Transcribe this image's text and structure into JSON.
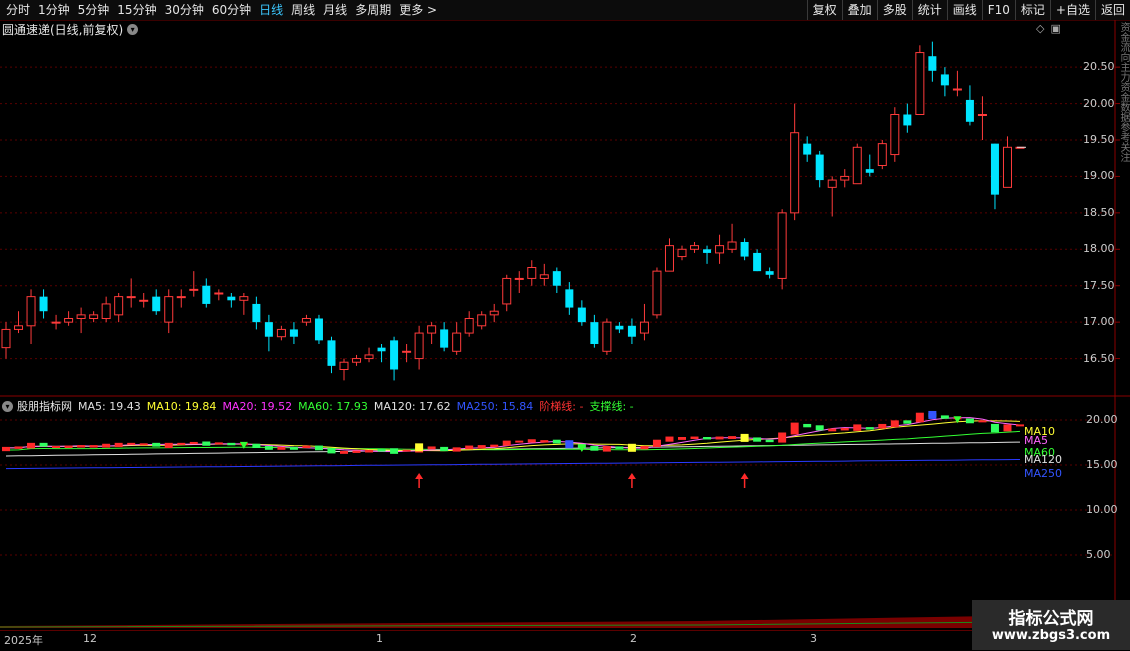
{
  "toolbar": {
    "periods": [
      "分时",
      "1分钟",
      "5分钟",
      "15分钟",
      "30分钟",
      "60分钟",
      "日线",
      "周线",
      "月线",
      "多周期",
      "更多 >"
    ],
    "active_period": "日线",
    "buttons": [
      "复权",
      "叠加",
      "多股",
      "统计",
      "画线",
      "F10",
      "标记",
      "+自选",
      "返回"
    ]
  },
  "stock_title": "圆通速递(日线,前复权)",
  "price_axis": [
    "20.50",
    "20.00",
    "19.50",
    "19.00",
    "18.50",
    "18.00",
    "17.50",
    "17.00",
    "16.50"
  ],
  "indicator": {
    "name": "股朋指标网",
    "ma": [
      {
        "label": "MA5: 19.43",
        "color": "#e0e0e0"
      },
      {
        "label": "MA10: 19.84",
        "color": "#ffff33"
      },
      {
        "label": "MA20: 19.52",
        "color": "#ff33ff"
      },
      {
        "label": "MA60: 17.93",
        "color": "#33ff33"
      },
      {
        "label": "MA120: 17.62",
        "color": "#e0e0e0"
      },
      {
        "label": "MA250: 15.84",
        "color": "#3355ff"
      }
    ],
    "step_line": "阶梯线: -",
    "support_line": "支撑线: -",
    "axis": [
      "20.00",
      "15.00",
      "10.00",
      "5.00"
    ],
    "line_labels": [
      {
        "label": "MA10",
        "color": "#ffff33"
      },
      {
        "label": "MA5",
        "color": "#ff66ff"
      },
      {
        "label": "MA60",
        "color": "#33ff33"
      },
      {
        "label": "MA120",
        "color": "#e0e0e0"
      },
      {
        "label": "MA250",
        "color": "#3355ff"
      }
    ]
  },
  "dates": [
    "2025年",
    "12",
    "1",
    "2",
    "3"
  ],
  "side_text": "资金流向主力资金数据参考关注",
  "watermark": {
    "line1": "指标公式网",
    "line2": "www.zbgs3.com"
  },
  "chart_data": {
    "type": "candlestick",
    "ylim": [
      16.0,
      20.9
    ],
    "candles": [
      [
        16.65,
        16.9,
        16.5,
        17.0
      ],
      [
        16.9,
        16.95,
        16.85,
        17.15
      ],
      [
        16.95,
        17.35,
        16.7,
        17.45
      ],
      [
        17.35,
        17.15,
        17.05,
        17.45
      ],
      [
        17.0,
        17.0,
        16.9,
        17.1
      ],
      [
        17.0,
        17.05,
        16.95,
        17.15
      ],
      [
        17.05,
        17.1,
        16.85,
        17.2
      ],
      [
        17.05,
        17.1,
        17.0,
        17.15
      ],
      [
        17.05,
        17.25,
        17.0,
        17.35
      ],
      [
        17.1,
        17.35,
        17.0,
        17.4
      ],
      [
        17.35,
        17.35,
        17.2,
        17.6
      ],
      [
        17.3,
        17.3,
        17.2,
        17.4
      ],
      [
        17.35,
        17.15,
        17.1,
        17.45
      ],
      [
        17.0,
        17.35,
        16.85,
        17.45
      ],
      [
        17.35,
        17.35,
        17.2,
        17.45
      ],
      [
        17.45,
        17.45,
        17.35,
        17.7
      ],
      [
        17.5,
        17.25,
        17.2,
        17.6
      ],
      [
        17.4,
        17.4,
        17.3,
        17.45
      ],
      [
        17.35,
        17.3,
        17.2,
        17.4
      ],
      [
        17.3,
        17.35,
        17.1,
        17.4
      ],
      [
        17.25,
        17.0,
        16.9,
        17.35
      ],
      [
        17.0,
        16.8,
        16.6,
        17.1
      ],
      [
        16.8,
        16.9,
        16.75,
        16.95
      ],
      [
        16.9,
        16.8,
        16.7,
        17.0
      ],
      [
        17.0,
        17.05,
        16.95,
        17.1
      ],
      [
        17.05,
        16.75,
        16.7,
        17.1
      ],
      [
        16.75,
        16.4,
        16.3,
        16.8
      ],
      [
        16.35,
        16.45,
        16.2,
        16.5
      ],
      [
        16.45,
        16.5,
        16.4,
        16.55
      ],
      [
        16.5,
        16.55,
        16.45,
        16.65
      ],
      [
        16.65,
        16.6,
        16.45,
        16.7
      ],
      [
        16.75,
        16.35,
        16.2,
        16.8
      ],
      [
        16.6,
        16.6,
        16.45,
        16.7
      ],
      [
        16.5,
        16.85,
        16.35,
        16.95
      ],
      [
        16.85,
        16.95,
        16.7,
        17.0
      ],
      [
        16.9,
        16.65,
        16.6,
        17.0
      ],
      [
        16.6,
        16.85,
        16.55,
        17.0
      ],
      [
        16.85,
        17.05,
        16.8,
        17.15
      ],
      [
        16.95,
        17.1,
        16.9,
        17.15
      ],
      [
        17.1,
        17.15,
        17.0,
        17.25
      ],
      [
        17.25,
        17.6,
        17.15,
        17.65
      ],
      [
        17.6,
        17.6,
        17.4,
        17.7
      ],
      [
        17.6,
        17.75,
        17.5,
        17.85
      ],
      [
        17.6,
        17.65,
        17.5,
        17.8
      ],
      [
        17.7,
        17.5,
        17.4,
        17.75
      ],
      [
        17.45,
        17.2,
        17.1,
        17.55
      ],
      [
        17.2,
        17.0,
        16.95,
        17.3
      ],
      [
        17.0,
        16.7,
        16.65,
        17.1
      ],
      [
        16.6,
        17.0,
        16.55,
        17.05
      ],
      [
        16.95,
        16.9,
        16.85,
        17.0
      ],
      [
        16.95,
        16.8,
        16.7,
        17.05
      ],
      [
        16.85,
        17.0,
        16.75,
        17.25
      ],
      [
        17.1,
        17.7,
        17.05,
        17.75
      ],
      [
        17.7,
        18.05,
        17.7,
        18.15
      ],
      [
        17.9,
        18.0,
        17.85,
        18.05
      ],
      [
        18.0,
        18.05,
        17.95,
        18.1
      ],
      [
        18.0,
        17.95,
        17.8,
        18.05
      ],
      [
        17.95,
        18.05,
        17.8,
        18.2
      ],
      [
        18.0,
        18.1,
        17.95,
        18.35
      ],
      [
        18.1,
        17.9,
        17.85,
        18.15
      ],
      [
        17.95,
        17.7,
        17.7,
        18.0
      ],
      [
        17.7,
        17.65,
        17.6,
        17.75
      ],
      [
        17.6,
        18.5,
        17.45,
        18.55
      ],
      [
        18.5,
        19.6,
        18.4,
        20.0
      ],
      [
        19.45,
        19.3,
        19.2,
        19.55
      ],
      [
        19.3,
        18.95,
        18.85,
        19.35
      ],
      [
        18.85,
        18.95,
        18.45,
        19.0
      ],
      [
        18.95,
        19.0,
        18.85,
        19.1
      ],
      [
        18.9,
        19.4,
        18.9,
        19.45
      ],
      [
        19.1,
        19.05,
        19.0,
        19.3
      ],
      [
        19.15,
        19.45,
        19.1,
        19.5
      ],
      [
        19.3,
        19.85,
        19.2,
        19.95
      ],
      [
        19.85,
        19.7,
        19.6,
        20.0
      ],
      [
        19.85,
        20.7,
        19.85,
        20.8
      ],
      [
        20.65,
        20.45,
        20.3,
        20.85
      ],
      [
        20.4,
        20.25,
        20.1,
        20.5
      ],
      [
        20.2,
        20.2,
        20.1,
        20.45
      ],
      [
        20.05,
        19.75,
        19.7,
        20.25
      ],
      [
        19.85,
        19.85,
        19.5,
        20.1
      ],
      [
        19.45,
        18.75,
        18.55,
        19.45
      ],
      [
        18.85,
        19.4,
        18.85,
        19.55
      ],
      [
        19.4,
        19.4,
        19.4,
        19.4
      ]
    ]
  }
}
